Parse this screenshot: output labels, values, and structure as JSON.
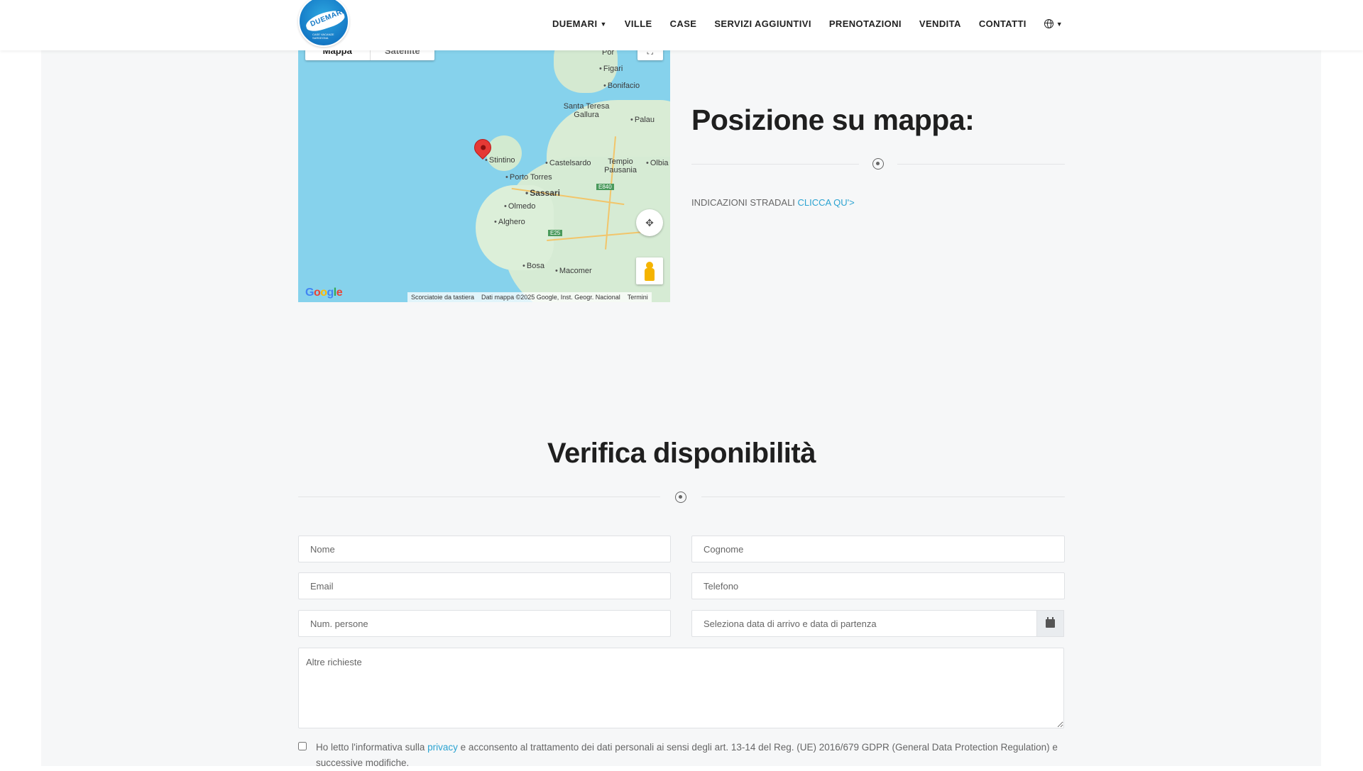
{
  "brand": {
    "logo_text": "DUEMARI",
    "logo_tagline": "CASE VACANZE SARDEGNA"
  },
  "nav": {
    "items": [
      {
        "label": "DUEMARI",
        "has_dropdown": true
      },
      {
        "label": "VILLE",
        "has_dropdown": false
      },
      {
        "label": "CASE",
        "has_dropdown": false
      },
      {
        "label": "SERVIZI AGGIUNTIVI",
        "has_dropdown": false
      },
      {
        "label": "PRENOTAZIONI",
        "has_dropdown": false
      },
      {
        "label": "VENDITA",
        "has_dropdown": false
      },
      {
        "label": "CONTATTI",
        "has_dropdown": false
      }
    ],
    "language_icon": "globe-icon"
  },
  "map": {
    "tab_map": "Mappa",
    "tab_satellite": "Satellite",
    "labels": [
      "Figari",
      "Bonifacio",
      "Santa Teresa Gallura",
      "Palau",
      "Stintino",
      "Castelsardo",
      "Tempio Pausania",
      "Olbia",
      "Porto Torres",
      "Sassari",
      "Olmedo",
      "Alghero",
      "Bosa",
      "Macomer",
      "E840",
      "E25",
      "Por"
    ],
    "google_logo": "Google",
    "attribution": {
      "shortcuts": "Scorciatoie da tastiera",
      "data": "Dati mappa ©2025 Google, Inst. Geogr. Nacional",
      "terms": "Termini"
    }
  },
  "position": {
    "title": "Posizione su mappa:",
    "directions_label": "INDICAZIONI STRADALI",
    "directions_link": "CLICCA QU'>"
  },
  "availability": {
    "title": "Verifica disponibilità",
    "fields": {
      "nome": "Nome",
      "cognome": "Cognome",
      "email": "Email",
      "telefono": "Telefono",
      "num_persone": "Num. persone",
      "date": "Seleziona data di arrivo e data di partenza",
      "altre": "Altre richieste"
    },
    "privacy_before": "Ho letto l'informativa sulla ",
    "privacy_link": "privacy",
    "privacy_after": " e acconsento al trattamento dei dati personali ai sensi degli art. 13-14 del Reg. (UE) 2016/679 GDPR (General Data Protection Regulation) e successive modifiche."
  },
  "colors": {
    "accent_link": "#2ba3d1",
    "map_water": "#86d2ec",
    "pin": "#e53935"
  }
}
